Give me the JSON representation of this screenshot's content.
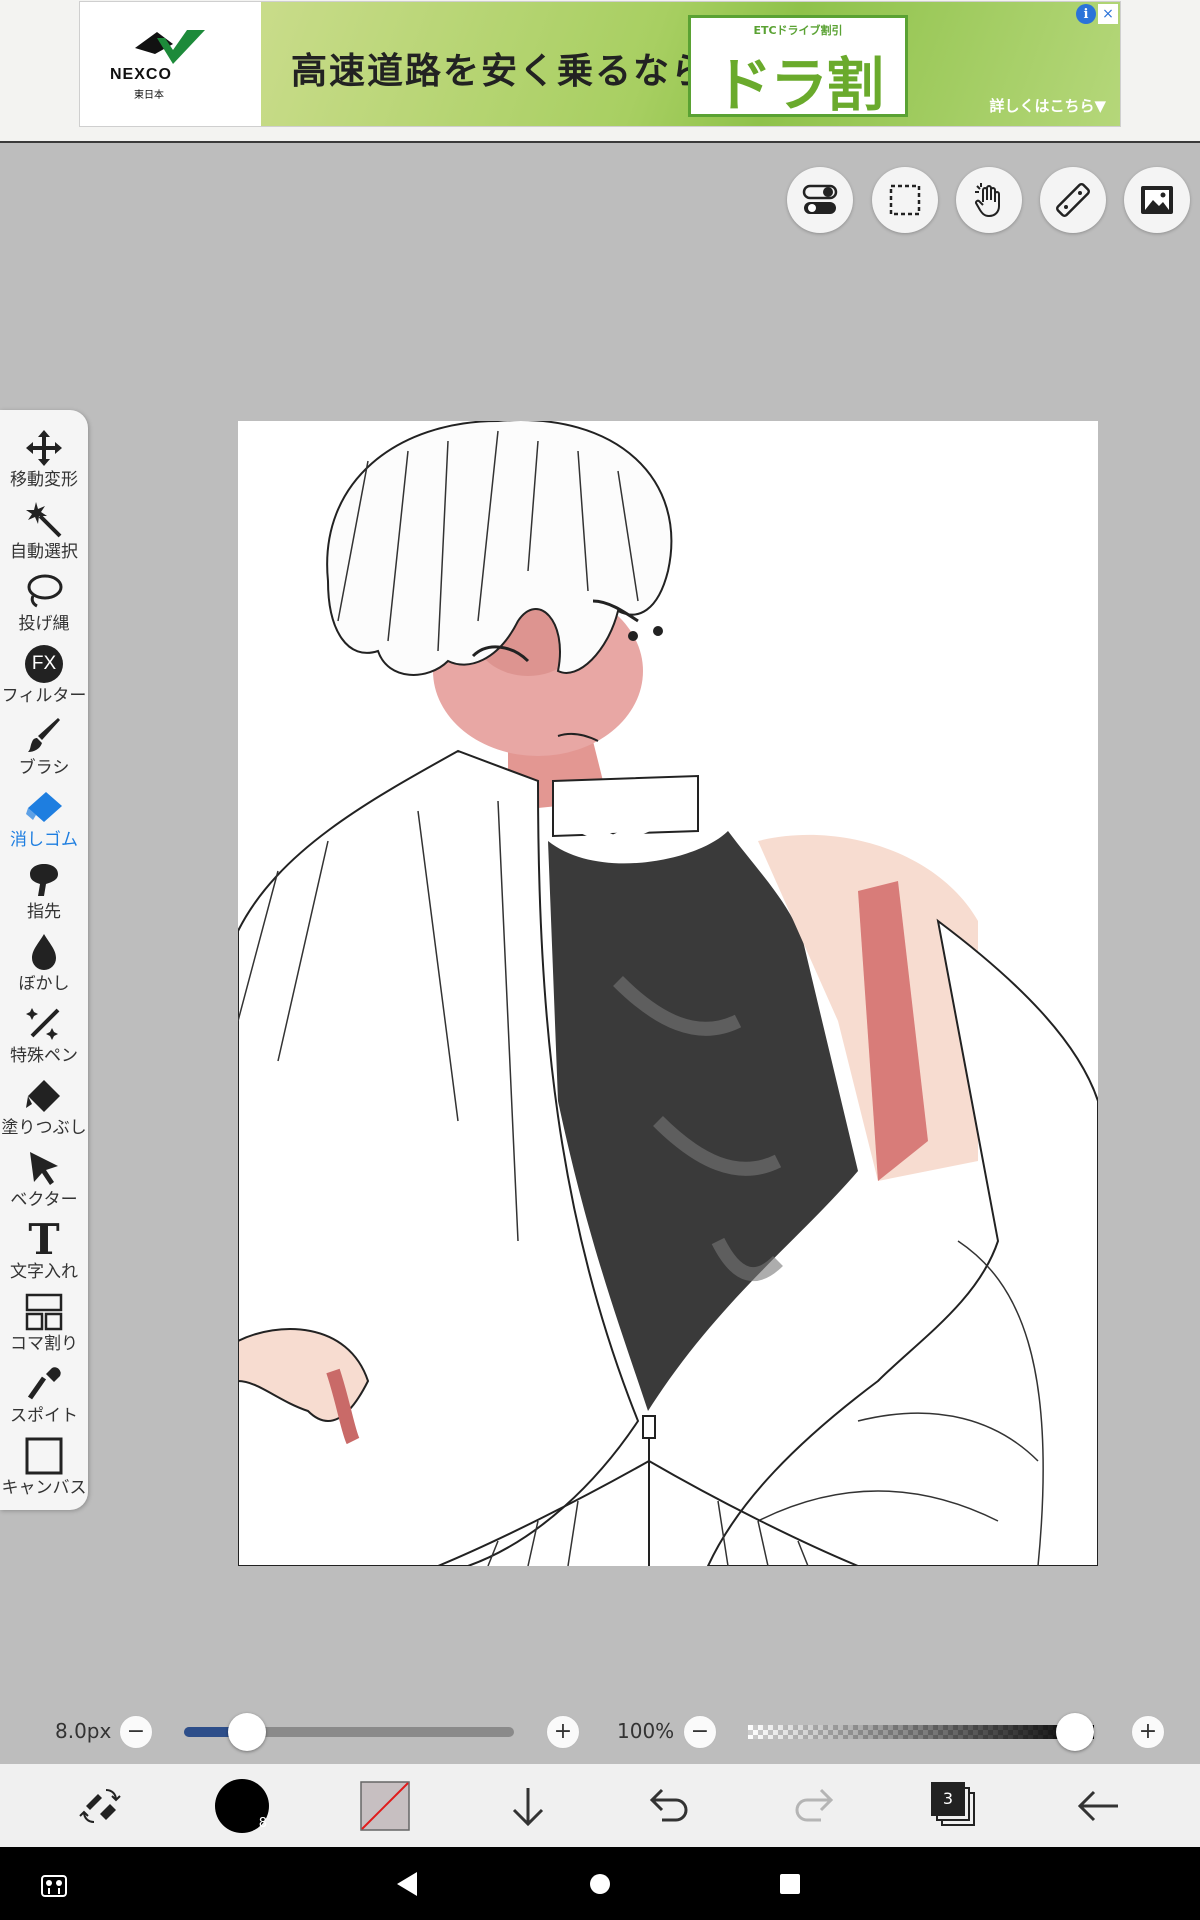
{
  "ad": {
    "brand": "NEXCO",
    "brand_sub": "東日本",
    "headline": "高速道路を安く乗るなら",
    "product_tag": "ETCドライブ割引",
    "product_name": "ドラ割",
    "more_link": "詳しくはこちら▼",
    "close_icon": "×",
    "info_icon": "i"
  },
  "top_tools": [
    {
      "name": "toggle-icon"
    },
    {
      "name": "selection-icon"
    },
    {
      "name": "hand-icon"
    },
    {
      "name": "ruler-icon"
    },
    {
      "name": "material-icon"
    }
  ],
  "tools": [
    {
      "label": "移動変形",
      "icon": "move-icon"
    },
    {
      "label": "自動選択",
      "icon": "magic-wand-icon"
    },
    {
      "label": "投げ縄",
      "icon": "lasso-icon"
    },
    {
      "label": "フィルター",
      "icon": "fx-icon",
      "glyph": "FX"
    },
    {
      "label": "ブラシ",
      "icon": "brush-icon"
    },
    {
      "label": "消しゴム",
      "icon": "eraser-icon",
      "active": true
    },
    {
      "label": "指先",
      "icon": "finger-icon"
    },
    {
      "label": "ぼかし",
      "icon": "blur-icon"
    },
    {
      "label": "特殊ペン",
      "icon": "special-pen-icon"
    },
    {
      "label": "塗りつぶし",
      "icon": "fill-icon"
    },
    {
      "label": "ベクター",
      "icon": "vector-icon"
    },
    {
      "label": "文字入れ",
      "icon": "text-icon",
      "glyph": "T"
    },
    {
      "label": "コマ割り",
      "icon": "panel-icon"
    },
    {
      "label": "スポイト",
      "icon": "eyedropper-icon"
    },
    {
      "label": "キャンバス",
      "icon": "canvas-icon"
    }
  ],
  "brush_size": {
    "value": "8.0px",
    "level": 0.19
  },
  "opacity": {
    "value": "100%",
    "level": 1.0
  },
  "minus_glyph": "−",
  "plus_glyph": "+",
  "layer_count": "3",
  "brush_badge": "8",
  "colors": {
    "accent": "#1e7ee0",
    "slider_fill": "#2d4e8a",
    "background": "#bdbdbd"
  }
}
